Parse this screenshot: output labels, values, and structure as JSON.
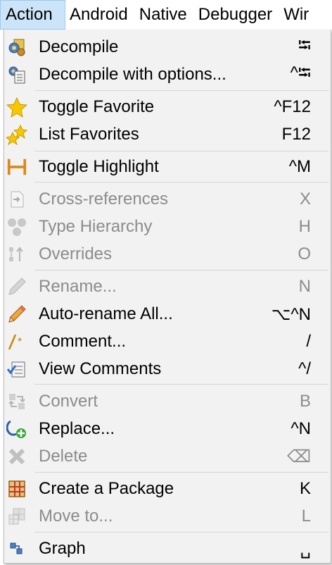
{
  "menubar": {
    "items": [
      {
        "label": "Action",
        "active": true
      },
      {
        "label": "Android"
      },
      {
        "label": "Native"
      },
      {
        "label": "Debugger"
      },
      {
        "label": "Wir"
      }
    ]
  },
  "menu": {
    "items": [
      {
        "label": "Decompile",
        "shortcut": "⭾",
        "icon": "decompile-icon",
        "enabled": true
      },
      {
        "label": "Decompile with options...",
        "shortcut": "^⭾",
        "icon": "decompile-options-icon",
        "enabled": true
      },
      {
        "label": "Toggle Favorite",
        "shortcut": "^F12",
        "icon": "star-icon",
        "enabled": true
      },
      {
        "label": "List Favorites",
        "shortcut": "F12",
        "icon": "stars-icon",
        "enabled": true
      },
      {
        "label": "Toggle Highlight",
        "shortcut": "^M",
        "icon": "highlight-icon",
        "enabled": true
      },
      {
        "label": "Cross-references",
        "shortcut": "X",
        "icon": "cross-references-icon",
        "enabled": false
      },
      {
        "label": "Type Hierarchy",
        "shortcut": "H",
        "icon": "type-hierarchy-icon",
        "enabled": false
      },
      {
        "label": "Overrides",
        "shortcut": "O",
        "icon": "overrides-icon",
        "enabled": false
      },
      {
        "label": "Rename...",
        "shortcut": "N",
        "icon": "pencil-icon",
        "enabled": false
      },
      {
        "label": "Auto-rename All...",
        "shortcut": "⌥^N",
        "icon": "pencil-icon",
        "enabled": true
      },
      {
        "label": "Comment...",
        "shortcut": "/",
        "icon": "comment-icon",
        "enabled": true
      },
      {
        "label": "View Comments",
        "shortcut": "^/",
        "icon": "view-comments-icon",
        "enabled": true
      },
      {
        "label": "Convert",
        "shortcut": "B",
        "icon": "convert-icon",
        "enabled": false
      },
      {
        "label": "Replace...",
        "shortcut": "^N",
        "icon": "replace-icon",
        "enabled": true
      },
      {
        "label": "Delete",
        "shortcut": "⌫",
        "icon": "delete-icon",
        "enabled": false
      },
      {
        "label": "Create a Package",
        "shortcut": "K",
        "icon": "package-icon",
        "enabled": true
      },
      {
        "label": "Move to...",
        "shortcut": "L",
        "icon": "move-icon",
        "enabled": false
      },
      {
        "label": "Graph",
        "shortcut": "␣",
        "icon": "graph-icon",
        "enabled": true
      }
    ]
  },
  "colors": {
    "menu_bg": "#f2f2f2",
    "active_menubar_bg": "#cce4f7",
    "disabled_text": "#8c8c8c",
    "separator": "#d6d6d6"
  }
}
